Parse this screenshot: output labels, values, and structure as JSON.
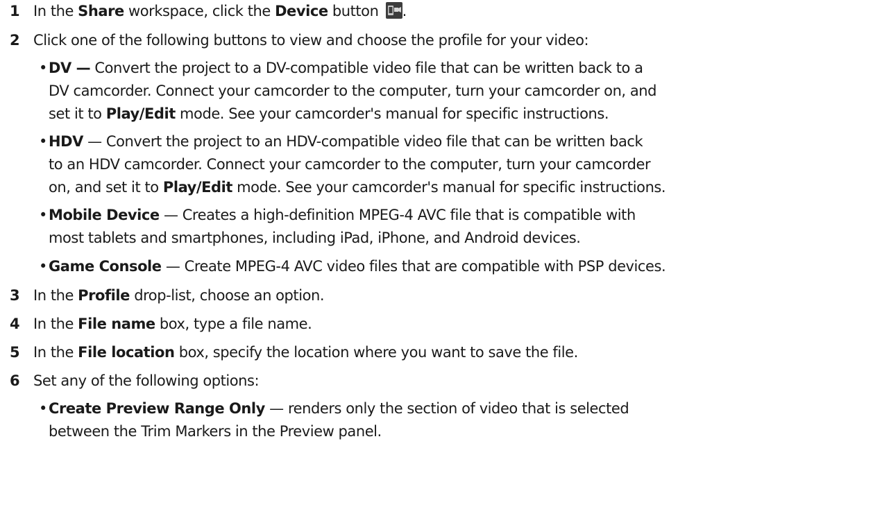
{
  "steps": [
    {
      "num": "1",
      "pre": "In the ",
      "b1": "Share",
      "mid": " workspace, click the ",
      "b2": "Device",
      "post": " button ",
      "end": ".",
      "icon": "device-icon"
    },
    {
      "num": "2",
      "text": "Click one of the following buttons to view and choose the profile for your video:"
    },
    {
      "num": "3",
      "pre": "In the ",
      "b1": "Profile",
      "post": " drop-list, choose an option."
    },
    {
      "num": "4",
      "pre": "In the ",
      "b1": "File name",
      "post": " box, type a file name."
    },
    {
      "num": "5",
      "pre": "In the ",
      "b1": "File location",
      "post": " box, specify the location where you want to save the file."
    },
    {
      "num": "6",
      "text": "Set any of the following options:"
    }
  ],
  "bullets": {
    "dv": {
      "term": "DV —",
      "line1": " Convert the project to a DV-compatible video file that can be written back to a",
      "line2": "DV camcorder. Connect your camcorder to the computer, turn your camcorder on, and",
      "line3_pre": "set it to ",
      "line3_b": "Play/Edit",
      "line3_post": " mode. See your camcorder's manual for specific instructions."
    },
    "hdv": {
      "term": "HDV",
      "line1": " — Convert the project to an HDV-compatible video file that can be written back",
      "line2": "to an HDV camcorder. Connect your camcorder to the computer, turn your camcorder",
      "line3_pre": "on, and set it to ",
      "line3_b": "Play/Edit",
      "line3_post": " mode. See your camcorder's manual for specific instructions."
    },
    "mobile": {
      "term": "Mobile Device",
      "line1": " — Creates a high-definition MPEG-4 AVC file that is compatible with",
      "line2": "most tablets and smartphones, including iPad, iPhone, and Android devices."
    },
    "game": {
      "term": "Game Console",
      "line1": " — Create MPEG-4 AVC video files that are compatible with PSP devices."
    },
    "preview": {
      "term": "Create Preview Range Only",
      "line1": " — renders only the section of video that is selected",
      "line2": "between the Trim Markers in the Preview panel."
    }
  },
  "bullet_char": "•"
}
